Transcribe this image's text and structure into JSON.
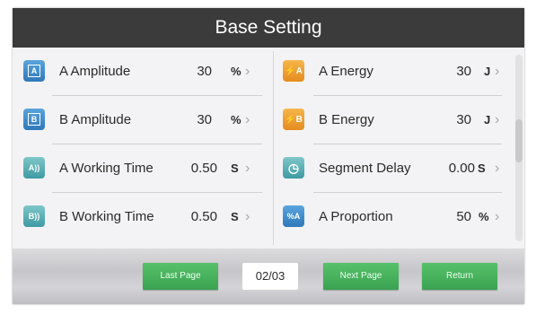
{
  "title": "Base Setting",
  "colors": {
    "titlebar": "#3b3b3b",
    "button_green": "#3aa251",
    "icon_blue": "#2f78bb",
    "icon_orange": "#e58b1f",
    "icon_teal": "#3f9aa3"
  },
  "left_settings": [
    {
      "label": "A Amplitude",
      "value": "30",
      "unit": "%",
      "icon": "amplitude-a-icon"
    },
    {
      "label": "B Amplitude",
      "value": "30",
      "unit": "%",
      "icon": "amplitude-b-icon"
    },
    {
      "label": "A Working Time",
      "value": "0.50",
      "unit": "S",
      "icon": "working-time-a-icon"
    },
    {
      "label": "B Working Time",
      "value": "0.50",
      "unit": "S",
      "icon": "working-time-b-icon"
    }
  ],
  "right_settings": [
    {
      "label": "A Energy",
      "value": "30",
      "unit": "J",
      "icon": "energy-a-icon"
    },
    {
      "label": "B Energy",
      "value": "30",
      "unit": "J",
      "icon": "energy-b-icon"
    },
    {
      "label": "Segment Delay",
      "value": "0.00",
      "unit": "S",
      "icon": "segment-delay-icon"
    },
    {
      "label": "A Proportion",
      "value": "50",
      "unit": "%",
      "icon": "proportion-a-icon"
    }
  ],
  "icons": {
    "amp_a": "A",
    "amp_b": "B",
    "wt_a": "A))",
    "wt_b": "B))",
    "energy_a": "⚡A",
    "energy_b": "⚡B",
    "delay": "◷",
    "proportion": "%A"
  },
  "chevron": "›",
  "footer": {
    "last_page": "Last Page",
    "page_indicator": "02/03",
    "next_page": "Next Page",
    "return": "Return"
  }
}
